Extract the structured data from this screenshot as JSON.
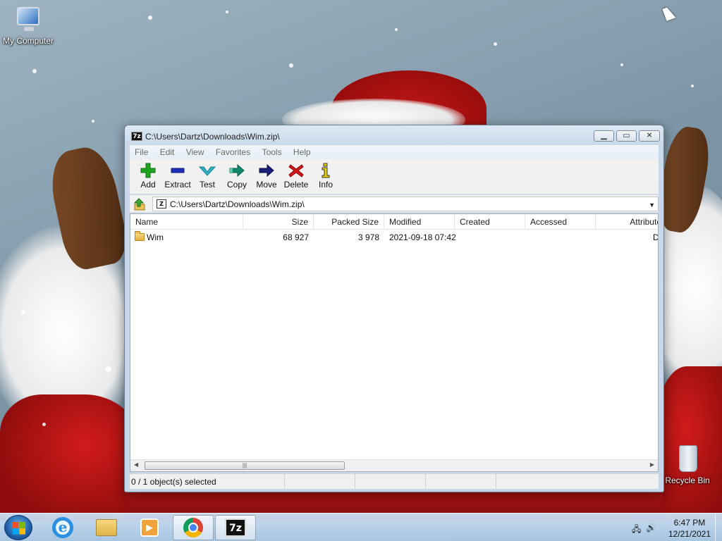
{
  "desktop": {
    "icons": [
      {
        "label": "My Computer"
      },
      {
        "label": "Recycle Bin"
      }
    ]
  },
  "window": {
    "title": "C:\\Users\\Dartz\\Downloads\\Wim.zip\\",
    "app_icon": "7z",
    "controls": {
      "minimize": "minimize-icon",
      "maximize": "maximize-icon",
      "close": "close-icon"
    },
    "menu": [
      "File",
      "Edit",
      "View",
      "Favorites",
      "Tools",
      "Help"
    ],
    "toolbar": [
      {
        "label": "Add",
        "icon": "plus-icon",
        "color": "#1ea51e"
      },
      {
        "label": "Extract",
        "icon": "minus-icon",
        "color": "#1d2fb8"
      },
      {
        "label": "Test",
        "icon": "check-icon",
        "color": "#2fb3c6"
      },
      {
        "label": "Copy",
        "icon": "copy-arrow-icon",
        "color": "#0f8a6b"
      },
      {
        "label": "Move",
        "icon": "move-arrow-icon",
        "color": "#18207a"
      },
      {
        "label": "Delete",
        "icon": "x-icon",
        "color": "#d01616"
      },
      {
        "label": "Info",
        "icon": "info-icon",
        "color": "#e8d000"
      }
    ],
    "address": {
      "path": "C:\\Users\\Dartz\\Downloads\\Wim.zip\\"
    },
    "list": {
      "columns": [
        "Name",
        "Size",
        "Packed Size",
        "Modified",
        "Created",
        "Accessed",
        "Attributes"
      ],
      "rows": [
        {
          "name": "Wim",
          "size": "68 927",
          "packed": "3 978",
          "modified": "2021-09-18 07:42",
          "created": "",
          "accessed": "",
          "attributes": "D"
        }
      ]
    },
    "status": {
      "selection": "0 / 1 object(s) selected"
    }
  },
  "taskbar": {
    "pinned": [
      "start-orb",
      "internet-explorer",
      "file-explorer",
      "media-player",
      "chrome",
      "7-zip"
    ],
    "clock": {
      "time": "6:47 PM",
      "date": "12/21/2021"
    }
  }
}
